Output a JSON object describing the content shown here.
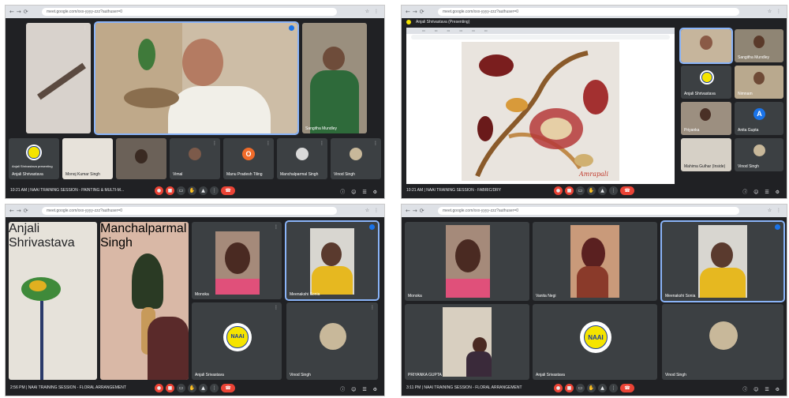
{
  "screenshots": [
    {
      "url": "meet.google.com/xxx-yyyy-zzz?authuser=0",
      "time_meeting": "10:21 AM  |  NAAI TRAINING SESSION - PAINTING & MULTI-M...",
      "participants": [
        {
          "name": "Anjali Shrivastava presenting"
        },
        {
          "name": "Sangitha Mundley"
        },
        {
          "name": "Anjali Shrivastava"
        },
        {
          "name": "Monoj Kumar Singh"
        },
        {
          "name": ""
        },
        {
          "name": "Vimal"
        },
        {
          "name": "Manu Pradesh Tiling",
          "initial": "O"
        },
        {
          "name": "Manchalparmal Singh"
        },
        {
          "name": "Vinod Singh"
        }
      ]
    },
    {
      "url": "meet.google.com/xxx-yyyy-zzz?authuser=0",
      "presenting_label": "Anjali Shrivastava (Presenting)",
      "time_meeting": "10:21 AM  |  NAAI TRAINING SESSION - FABRIC/DRY",
      "slide_caption": "Amrapali",
      "participants": [
        {
          "name": "Anjali Shrivastava"
        },
        {
          "name": "Sangitha Mundley"
        },
        {
          "name": "Anjali Shrivastava"
        },
        {
          "name": "Nimnam"
        },
        {
          "name": "Priyanka"
        },
        {
          "name": "Anita Gupta",
          "initial": "A"
        },
        {
          "name": "Mahima Gulhar (Inside)"
        },
        {
          "name": "Vinod Singh"
        }
      ]
    },
    {
      "url": "meet.google.com/xxx-yyyy-zzz?authuser=0",
      "time_meeting": "2:56 PM  |  NAAI TRAINING SESSION - FLORAL ARRANGEMENT",
      "participants": [
        {
          "name": "Anjali Shrivastava"
        },
        {
          "name": "Manchalparmal Singh"
        },
        {
          "name": "Monoka"
        },
        {
          "name": "Meenakshi Sonia"
        },
        {
          "name": "Anjali Srivastava"
        },
        {
          "name": "Vinod Singh"
        }
      ],
      "logo_text": "NAAI"
    },
    {
      "url": "meet.google.com/xxx-yyyy-zzz?authuser=0",
      "time_meeting": "3:11 PM  |  NAAI TRAINING SESSION - FLORAL ARRANGEMENT",
      "participants": [
        {
          "name": "Monoka"
        },
        {
          "name": "Vanita Negi"
        },
        {
          "name": "Meenakshi Sonia"
        },
        {
          "name": "PRIYANKA GUPTA"
        },
        {
          "name": "Anjali Srivastava"
        },
        {
          "name": "Vinod Singh"
        }
      ],
      "logo_text": "NAAI"
    }
  ],
  "controls": {
    "end_call": "☎",
    "more": "⋮",
    "right_icons": "ⓘ ☺ ☰ ⚙"
  },
  "colors": {
    "meet_bg": "#202124",
    "tile_bg": "#3c4043",
    "end_call": "#ea4335",
    "active": "#8ab4f8",
    "logo_yellow": "#f5e400"
  }
}
